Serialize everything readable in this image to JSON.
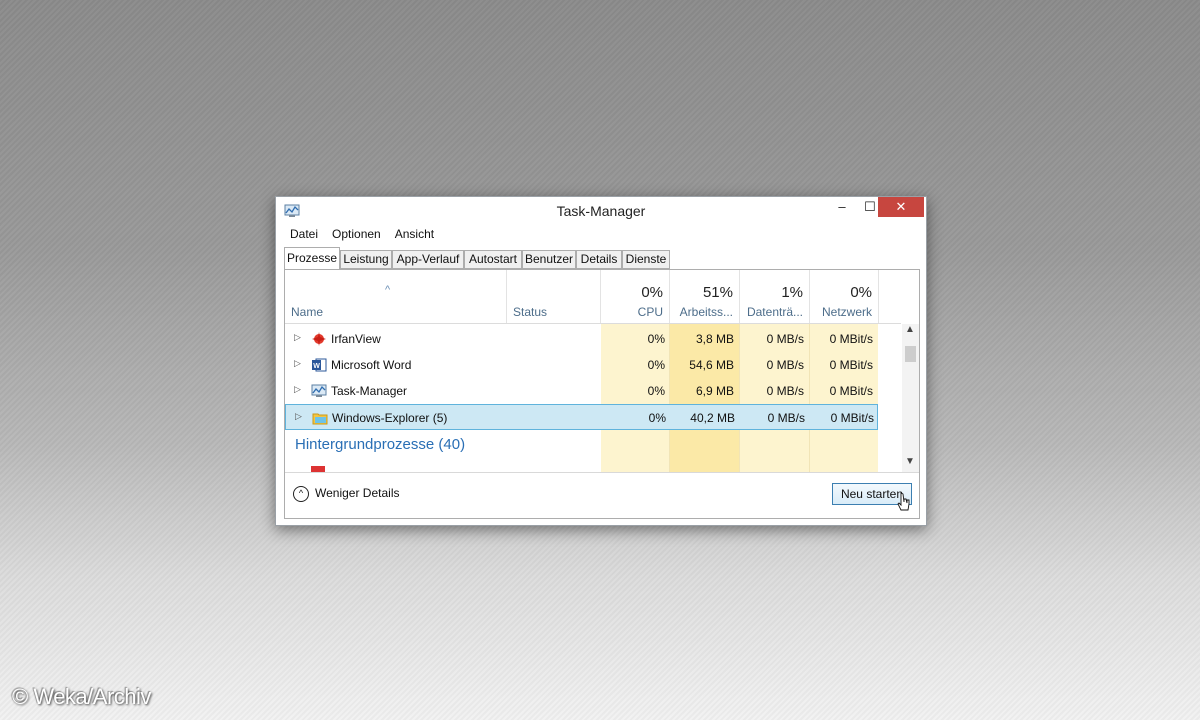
{
  "window": {
    "title": "Task-Manager",
    "controls": {
      "minimize": "–",
      "maximize": "☐",
      "close": "✕"
    },
    "close_color": "#c7463f"
  },
  "menu": [
    "Datei",
    "Optionen",
    "Ansicht"
  ],
  "tabs": [
    "Prozesse",
    "Leistung",
    "App-Verlauf",
    "Autostart",
    "Benutzer",
    "Details",
    "Dienste"
  ],
  "active_tab": "Prozesse",
  "columns": {
    "name": "Name",
    "status": "Status",
    "cpu": {
      "pct": "0%",
      "label": "CPU"
    },
    "memory": {
      "pct": "51%",
      "label": "Arbeitss..."
    },
    "disk": {
      "pct": "1%",
      "label": "Datenträ..."
    },
    "network": {
      "pct": "0%",
      "label": "Netzwerk"
    }
  },
  "processes": [
    {
      "name": "IrfanView",
      "icon": "irfanview-icon",
      "cpu": "0%",
      "memory": "3,8 MB",
      "disk": "0 MB/s",
      "network": "0 MBit/s"
    },
    {
      "name": "Microsoft Word",
      "icon": "word-icon",
      "cpu": "0%",
      "memory": "54,6 MB",
      "disk": "0 MB/s",
      "network": "0 MBit/s"
    },
    {
      "name": "Task-Manager",
      "icon": "task-manager-icon",
      "cpu": "0%",
      "memory": "6,9 MB",
      "disk": "0 MB/s",
      "network": "0 MBit/s"
    },
    {
      "name": "Windows-Explorer (5)",
      "icon": "explorer-icon",
      "cpu": "0%",
      "memory": "40,2 MB",
      "disk": "0 MB/s",
      "network": "0 MBit/s",
      "selected": true
    }
  ],
  "group_title": "Hintergrundprozesse (40)",
  "footer": {
    "less_details": "Weniger Details",
    "restart_button": "Neu starten"
  },
  "watermark": "© Weka/Archiv",
  "colors": {
    "selection": "#cde8f4",
    "selection_border": "#5fb3dc",
    "usage_light": "#fdf4cf",
    "usage_medium": "#fbe9a7",
    "group_title": "#2a6fb5"
  }
}
